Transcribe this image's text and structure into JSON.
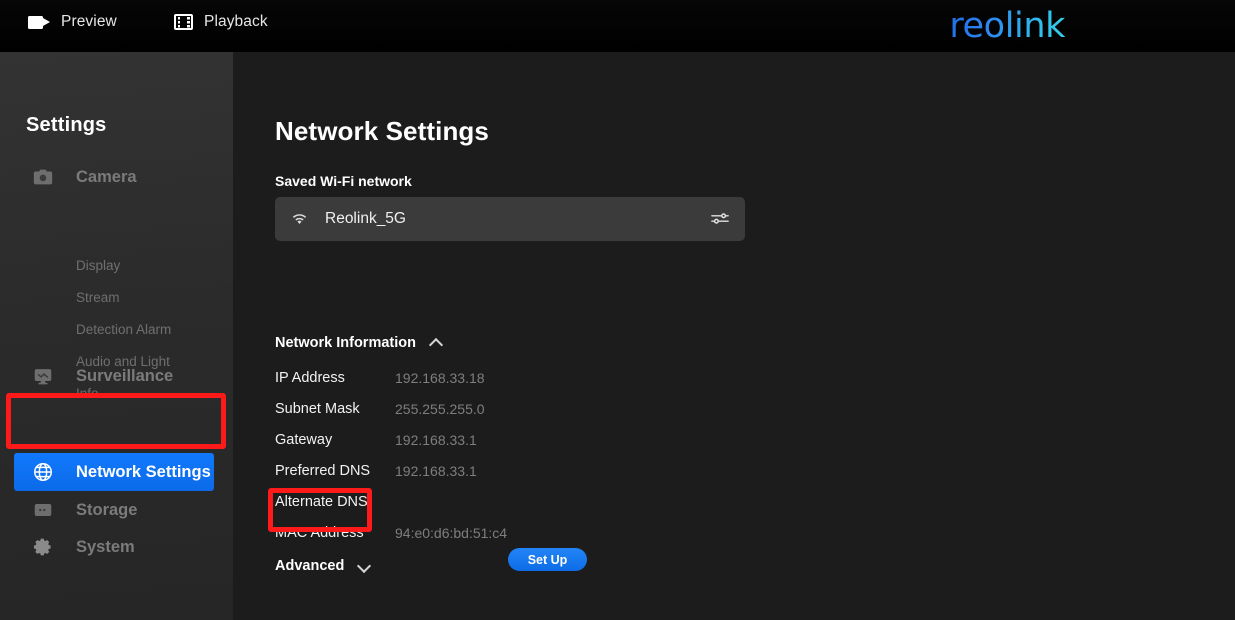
{
  "topbar": {
    "nav": [
      {
        "label": "Preview",
        "icon": "camcorder-icon"
      },
      {
        "label": "Playback",
        "icon": "film-strip-icon"
      }
    ],
    "logo_text": "reolink",
    "logo_gradient_from": "#1f6fe8",
    "logo_gradient_to": "#35d3e8"
  },
  "sidebar": {
    "title": "Settings",
    "groups": [
      {
        "label": "Camera",
        "icon": "camera-icon",
        "children": [
          {
            "label": "Display"
          },
          {
            "label": "Stream"
          },
          {
            "label": "Detection Alarm"
          },
          {
            "label": "Audio and Light"
          },
          {
            "label": "Info"
          }
        ]
      },
      {
        "label": "Surveillance",
        "icon": "monitor-icon",
        "children": []
      },
      {
        "label": "Network Settings",
        "icon": "globe-icon",
        "active": true,
        "children": []
      },
      {
        "label": "Storage",
        "icon": "storage-icon",
        "children": []
      },
      {
        "label": "System",
        "icon": "gear-icon",
        "children": []
      }
    ],
    "active_color": "#0d6efd"
  },
  "main": {
    "page_title": "Network Settings",
    "saved_wifi": {
      "label": "Saved Wi-Fi network",
      "ssid": "Reolink_5G",
      "wifi_icon": "wifi-icon",
      "config_icon": "tune-sliders-icon"
    },
    "network_information": {
      "title": "Network Information",
      "expanded": true,
      "chevron": "chevron-up-icon",
      "rows": [
        {
          "key": "IP Address",
          "value": "192.168.33.18"
        },
        {
          "key": "Subnet Mask",
          "value": "255.255.255.0"
        },
        {
          "key": "Gateway",
          "value": "192.168.33.1"
        },
        {
          "key": "Preferred DNS",
          "value": "192.168.33.1"
        },
        {
          "key": "Alternate DNS",
          "value": ""
        },
        {
          "key": "MAC Address",
          "value": "94:e0:d6:bd:51:c4"
        }
      ]
    },
    "setup_button": "Set Up",
    "advanced": {
      "title": "Advanced",
      "expanded": false,
      "chevron": "chevron-down-icon"
    }
  },
  "annotations": {
    "color": "#ff1a1a",
    "highlights": [
      "Network Settings sidebar item",
      "Set Up button"
    ]
  }
}
